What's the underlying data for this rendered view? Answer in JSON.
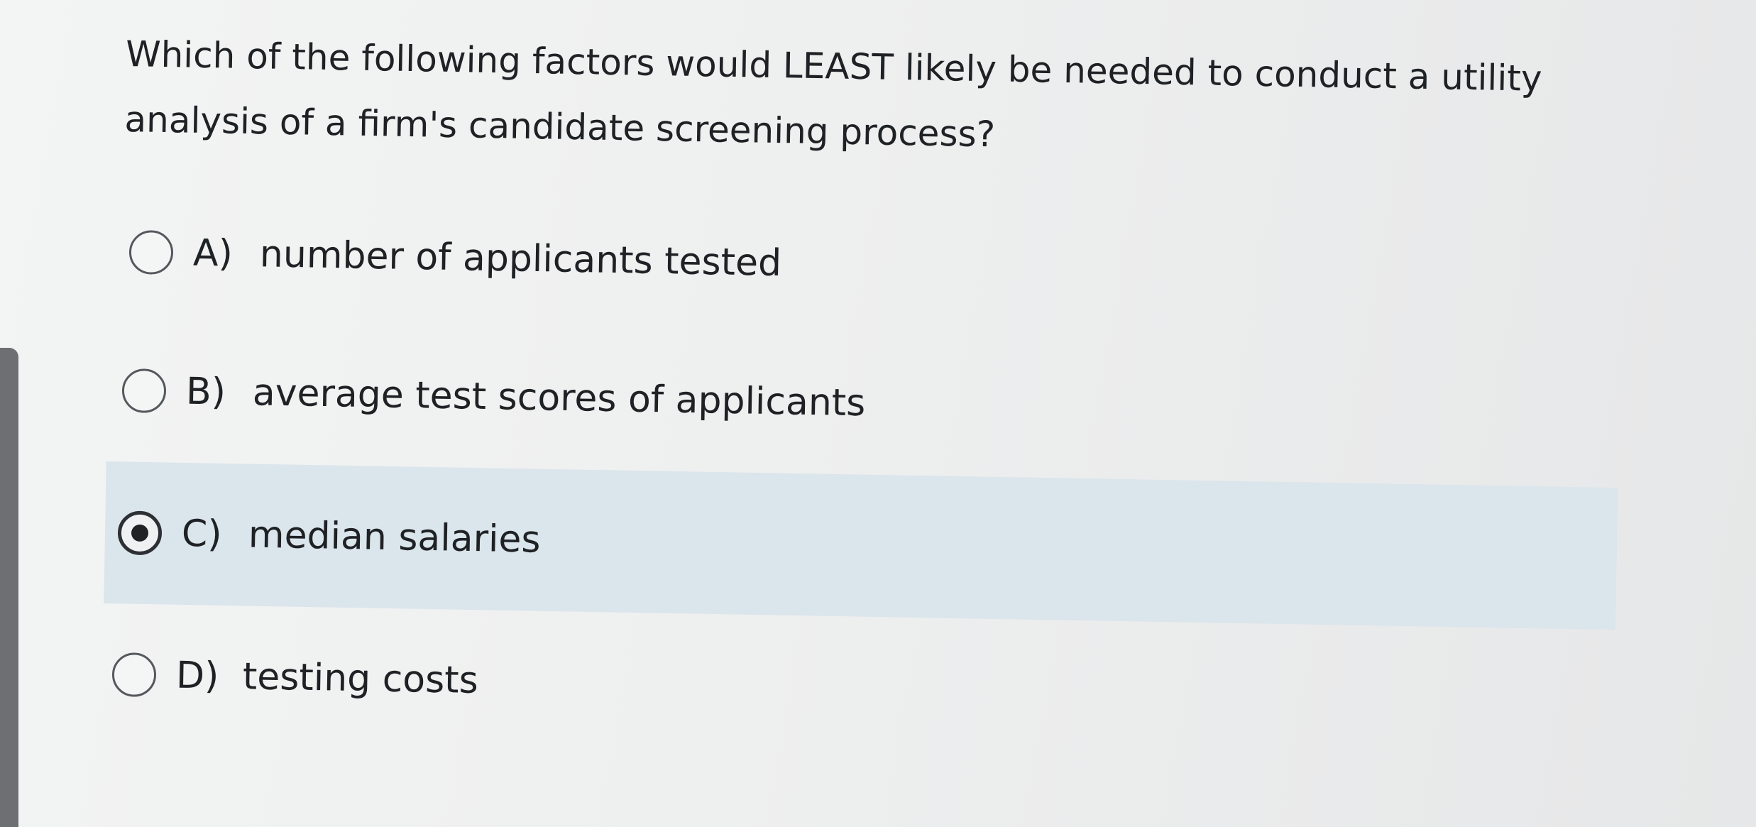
{
  "question": {
    "text": "Which of the following factors would LEAST likely be needed to conduct a utility analysis of a firm's candidate screening process?"
  },
  "options": [
    {
      "letter": "A)",
      "text": "number of applicants tested",
      "selected": false
    },
    {
      "letter": "B)",
      "text": "average test scores of applicants",
      "selected": false
    },
    {
      "letter": "C)",
      "text": "median salaries",
      "selected": true
    },
    {
      "letter": "D)",
      "text": "testing costs",
      "selected": false
    }
  ],
  "colors": {
    "selected_row_background": "#dbe5ec",
    "scrollbar_thumb": "#6d6f72"
  }
}
